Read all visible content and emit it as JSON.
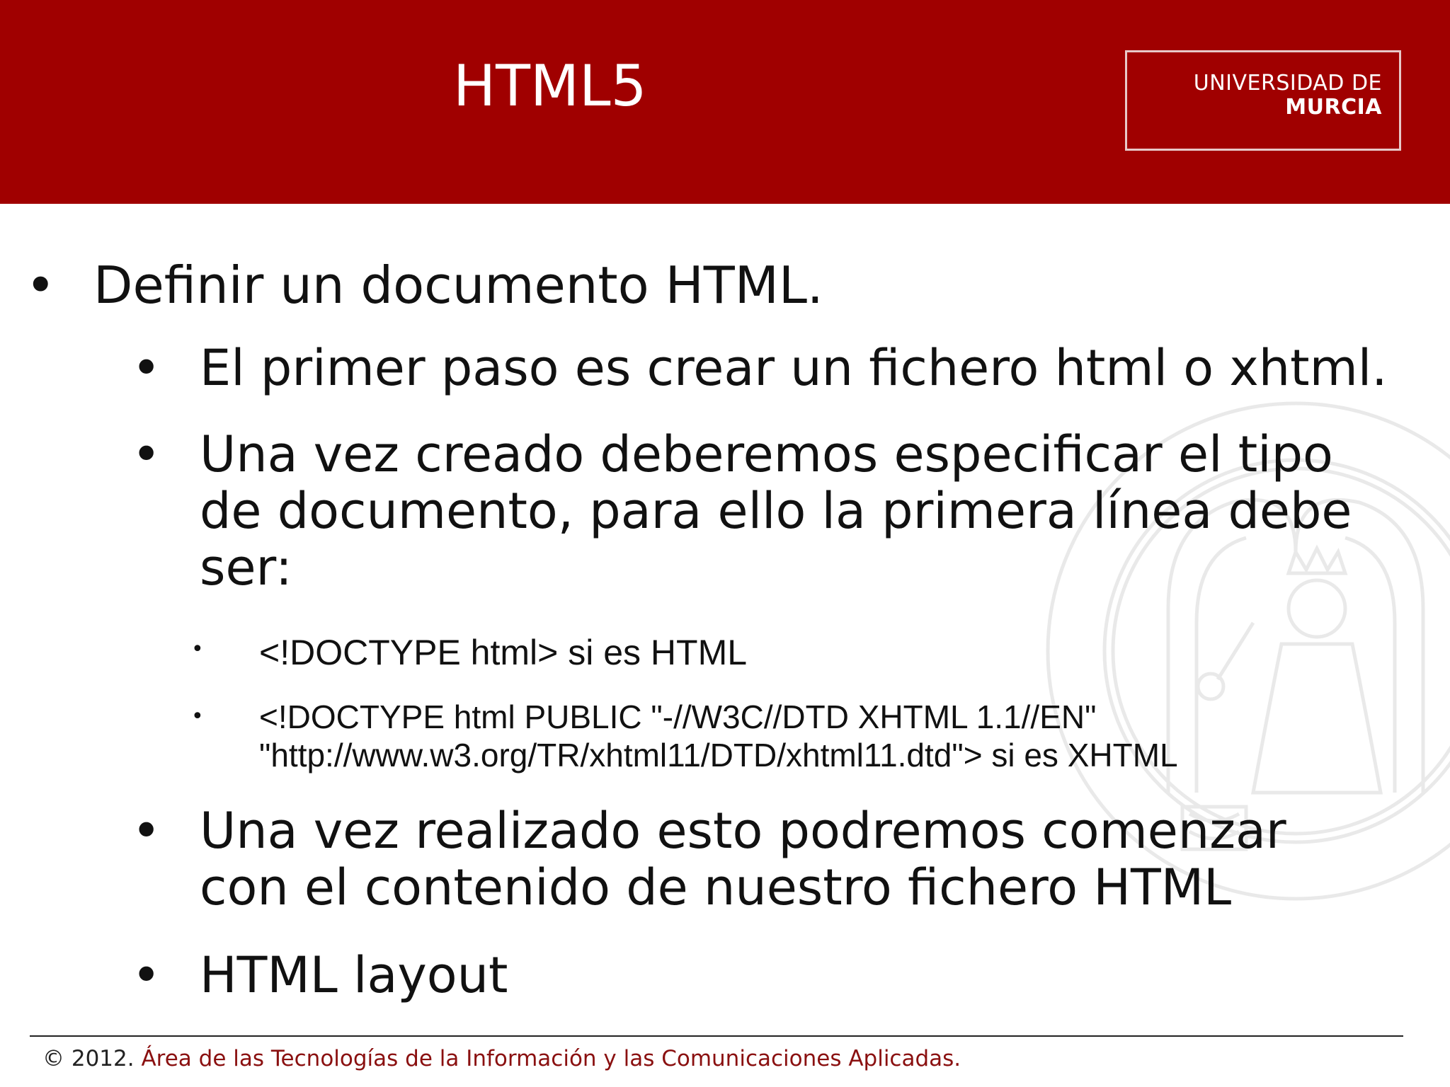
{
  "header": {
    "title": "HTML5",
    "logo_line1": "UNIVERSIDAD DE",
    "logo_line2": "MURCIA"
  },
  "bullets": {
    "b1": "Definir un documento HTML.",
    "b2": "El primer paso es crear un fichero html o xhtml.",
    "b3_line1": "Una vez creado deberemos especificar el tipo",
    "b3_line2": "de documento, para ello la primera línea debe",
    "b3_line3": "ser:",
    "b4": "<!DOCTYPE html> si es HTML",
    "b5_line1": "<!DOCTYPE html PUBLIC \"-//W3C//DTD XHTML 1.1//EN\"",
    "b5_line2": "\"http://www.w3.org/TR/xhtml11/DTD/xhtml11.dtd\"> si es XHTML",
    "b6_line1": "Una vez realizado esto podremos comenzar",
    "b6_line2": "con el contenido de nuestro fichero HTML",
    "b7": "HTML layout",
    "bullet_char": "•"
  },
  "footer": {
    "copyright": "© 2012.",
    "org": "Área de las Tecnologías de la Información y las Comunicaciones Aplicadas."
  },
  "colors": {
    "header_bg": "#a00000",
    "footer_org": "#8a1010"
  },
  "icons": {
    "watermark": "university-seal-watermark"
  }
}
